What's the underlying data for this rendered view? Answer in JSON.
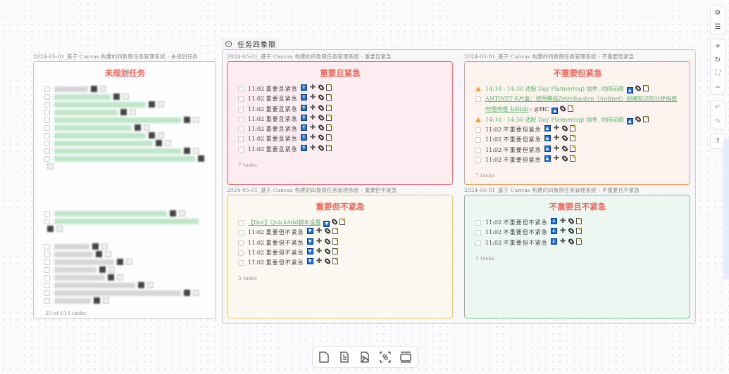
{
  "group": {
    "title": "任务四象限",
    "collapse_icon": "minus-circle-icon"
  },
  "unplanned": {
    "label": "2024-05-01_基于 Canvas 构建的四象限任务管理系统 › 未规划任务",
    "title": "未规划任务",
    "count": "20 of 613 tasks"
  },
  "quadrants": [
    {
      "label": "2024-05-01_基于 Canvas 构建的四象限任务管理系统 › 重要且紧急",
      "title": "重要且紧急",
      "count": "7 tasks",
      "border": "#e8707c",
      "bg": "#fbedf0",
      "tasks": [
        {
          "time": "11:02",
          "text": "重要且紧急"
        },
        {
          "time": "11:02",
          "text": "重要且紧急"
        },
        {
          "time": "11:02",
          "text": "重要且紧急"
        },
        {
          "time": "11:02",
          "text": "重要且紧急"
        },
        {
          "time": "11:02",
          "text": "重要且紧急"
        },
        {
          "time": "11:02",
          "text": "重要且紧急"
        },
        {
          "time": "11:02",
          "text": "重要且紧急"
        }
      ]
    },
    {
      "label": "2024-05-01_基于 Canvas 构建的四象限任务管理系统 › 不重要但紧急",
      "title": "不重要但紧急",
      "count": "7 tasks",
      "border": "#f0a050",
      "bg": "#fcf2ee",
      "special": [
        {
          "text": "14:10 - 14:30 适配 Day Planner(og) 插件, 时间前缀"
        },
        {
          "text": "ANTINET卡片盒：使用模拟Zettelkasten（Antinet）创建知识的分步指南 哔哩哔哩_bilibili",
          "suffix": "@HC"
        },
        {
          "text": "14:10 - 14:30 适配 Day Planner(og) 插件, 时间前缀"
        }
      ],
      "tasks": [
        {
          "time": "11:02",
          "text": "不重要但紧急"
        },
        {
          "time": "11:02",
          "text": "不重要但紧急"
        },
        {
          "time": "11:02",
          "text": "不重要但紧急"
        },
        {
          "time": "11:02",
          "text": "不重要但紧急"
        }
      ]
    },
    {
      "label": "2024-05-01_基于 Canvas 构建的四象限任务管理系统 › 重要但不紧急",
      "title": "重要但不紧急",
      "count": "5 tasks",
      "border": "#e8c860",
      "bg": "#fbf7f1",
      "special": [
        {
          "text": "【Doc】QuickAdd脚本设置"
        }
      ],
      "tasks": [
        {
          "time": "11:02",
          "text": "重要但不紧急"
        },
        {
          "time": "11:02",
          "text": "重要但不紧急"
        },
        {
          "time": "11:02",
          "text": "重要但不紧急"
        },
        {
          "time": "11:02",
          "text": "重要但不紧急"
        }
      ]
    },
    {
      "label": "2024-05-01_基于 Canvas 构建的四象限任务管理系统 › 不重要且不紧急",
      "title": "不重要且不紧急",
      "count": "3 tasks",
      "border": "#6cc88a",
      "bg": "#ecf7f2",
      "tasks": [
        {
          "time": "11:02",
          "text": "不重要但不紧急"
        },
        {
          "time": "11:02",
          "text": "不重要但不紧急"
        },
        {
          "time": "11:02",
          "text": "不重要但不紧急"
        }
      ]
    }
  ],
  "colors": {
    "title": "#f0645a",
    "link": "#5bb36b",
    "priority": "#1a6fd8"
  },
  "right_toolbar": [
    "settings-icon",
    "sliders-icon",
    "zoom-in-icon",
    "reset-icon",
    "fit-icon",
    "zoom-out-icon",
    "undo-icon",
    "redo-icon",
    "help-icon"
  ],
  "bottom_toolbar": [
    "new-card-icon",
    "new-note-icon",
    "add-media-icon",
    "group-icon",
    "frame-icon"
  ]
}
